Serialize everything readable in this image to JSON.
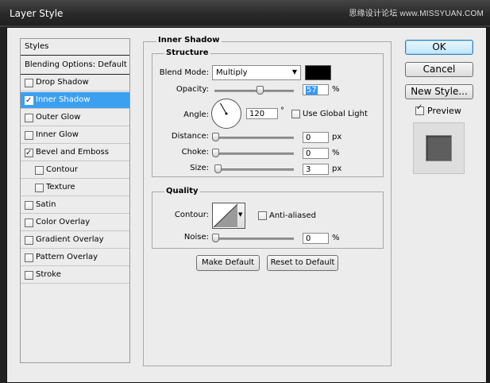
{
  "window": {
    "title": "Layer Style",
    "watermark": "思缘设计论坛 www.MISSYUAN.COM"
  },
  "styles_list": {
    "header": "Styles",
    "blending": "Blending Options: Default",
    "items": [
      {
        "label": "Drop Shadow",
        "checked": false,
        "selected": false,
        "indent": false
      },
      {
        "label": "Inner Shadow",
        "checked": true,
        "selected": true,
        "indent": false
      },
      {
        "label": "Outer Glow",
        "checked": false,
        "selected": false,
        "indent": false
      },
      {
        "label": "Inner Glow",
        "checked": false,
        "selected": false,
        "indent": false
      },
      {
        "label": "Bevel and Emboss",
        "checked": true,
        "selected": false,
        "indent": false
      },
      {
        "label": "Contour",
        "checked": false,
        "selected": false,
        "indent": true
      },
      {
        "label": "Texture",
        "checked": false,
        "selected": false,
        "indent": true
      },
      {
        "label": "Satin",
        "checked": false,
        "selected": false,
        "indent": false
      },
      {
        "label": "Color Overlay",
        "checked": false,
        "selected": false,
        "indent": false
      },
      {
        "label": "Gradient Overlay",
        "checked": false,
        "selected": false,
        "indent": false
      },
      {
        "label": "Pattern Overlay",
        "checked": false,
        "selected": false,
        "indent": false
      },
      {
        "label": "Stroke",
        "checked": false,
        "selected": false,
        "indent": false
      }
    ]
  },
  "panel": {
    "title": "Inner Shadow",
    "structure": {
      "title": "Structure",
      "blend_mode_label": "Blend Mode:",
      "blend_mode_value": "Multiply",
      "shadow_color": "#000000",
      "opacity_label": "Opacity:",
      "opacity_value": "57",
      "opacity_fraction": 0.57,
      "percent": "%",
      "angle_label": "Angle:",
      "angle_value": "120",
      "angle_degrees": 120,
      "degree_symbol": "°",
      "use_global_light": "Use Global Light",
      "distance_label": "Distance:",
      "distance_value": "0",
      "px": "px",
      "choke_label": "Choke:",
      "choke_value": "0",
      "size_label": "Size:",
      "size_value": "3"
    },
    "quality": {
      "title": "Quality",
      "contour_label": "Contour:",
      "anti_aliased": "Anti-aliased",
      "noise_label": "Noise:",
      "noise_value": "0",
      "percent": "%"
    },
    "make_default": "Make Default",
    "reset_default": "Reset to Default"
  },
  "buttons": {
    "ok": "OK",
    "cancel": "Cancel",
    "new_style": "New Style...",
    "preview": "Preview"
  }
}
